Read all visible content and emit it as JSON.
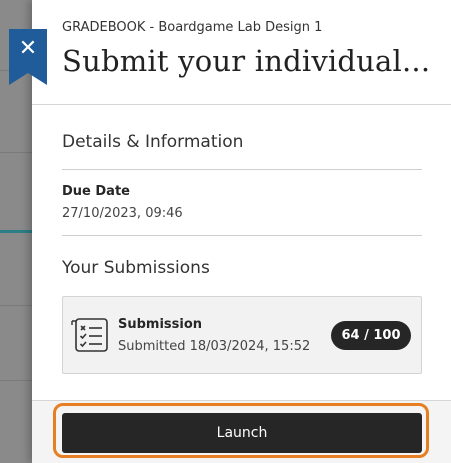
{
  "header": {
    "breadcrumb": "GRADEBOOK - Boardgame Lab Design 1",
    "title": "Submit your individual...",
    "close_label": "✕"
  },
  "details": {
    "heading": "Details & Information",
    "due_label": "Due Date",
    "due_value": "27/10/2023, 09:46"
  },
  "submissions": {
    "heading": "Your Submissions",
    "items": [
      {
        "title": "Submission",
        "meta": "Submitted 18/03/2024, 15:52",
        "grade": "64 / 100"
      }
    ]
  },
  "footer": {
    "launch_label": "Launch"
  },
  "colors": {
    "ribbon": "#1f5c99",
    "focus_ring": "#e67e22",
    "button": "#262626",
    "accent_line": "#2a7f86"
  },
  "icons": {
    "close": "close-icon",
    "submission": "checklist-icon"
  }
}
